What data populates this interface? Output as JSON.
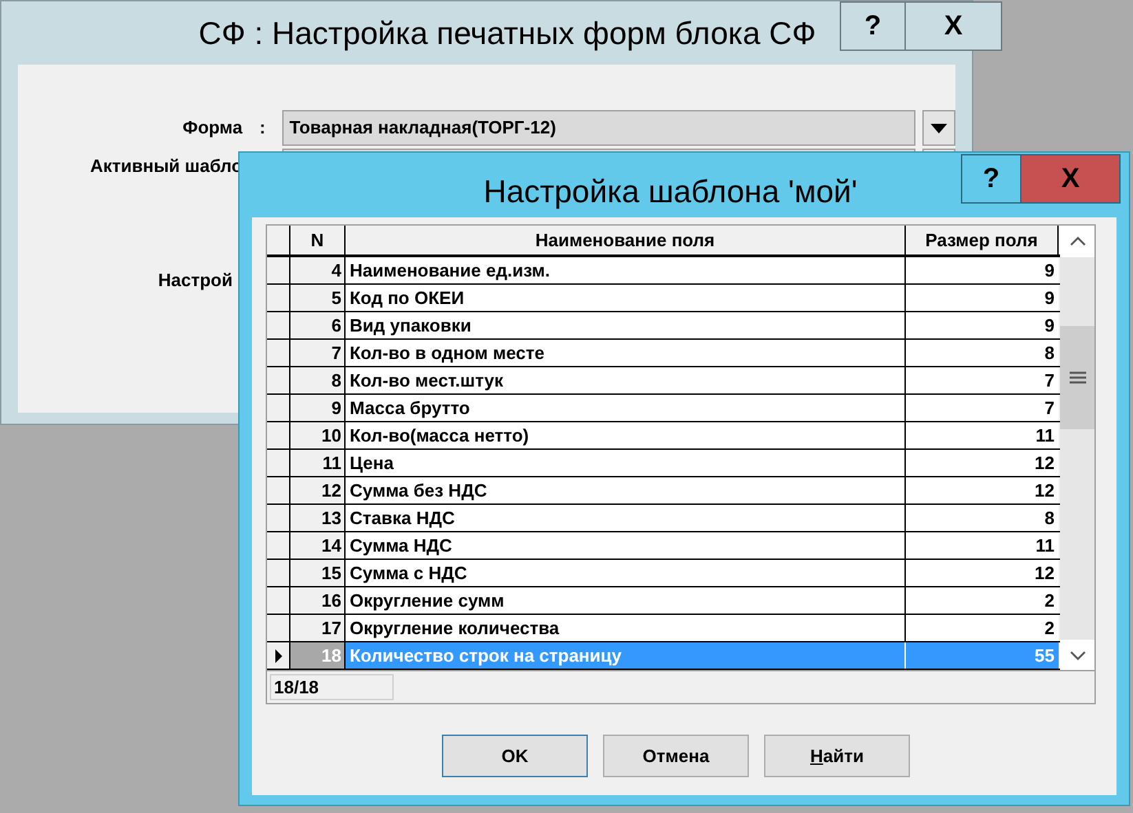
{
  "main_window": {
    "title": "СФ : Настройка печатных форм блока СФ",
    "help_button": "?",
    "close_button": "X",
    "fields": [
      {
        "label": "Форма",
        "separator": ":",
        "value": "Товарная накладная(ТОРГ-12)"
      },
      {
        "label": "Активный шабло"
      }
    ],
    "labels": [
      "Настрой"
    ]
  },
  "dialog": {
    "title": "Настройка шаблона 'мой'",
    "help_button": "?",
    "close_button": "X",
    "table": {
      "columns": [
        "N",
        "Наименование поля",
        "Размер поля"
      ],
      "rows": [
        {
          "n": "4",
          "name": "Наименование ед.изм.",
          "size": "9",
          "selected": false
        },
        {
          "n": "5",
          "name": "Код по ОКЕИ",
          "size": "9",
          "selected": false
        },
        {
          "n": "6",
          "name": "Вид упаковки",
          "size": "9",
          "selected": false
        },
        {
          "n": "7",
          "name": "Кол-во в одном месте",
          "size": "8",
          "selected": false
        },
        {
          "n": "8",
          "name": "Кол-во мест.штук",
          "size": "7",
          "selected": false
        },
        {
          "n": "9",
          "name": "Масса брутто",
          "size": "7",
          "selected": false
        },
        {
          "n": "10",
          "name": "Кол-во(масса нетто)",
          "size": "11",
          "selected": false
        },
        {
          "n": "11",
          "name": "Цена",
          "size": "12",
          "selected": false
        },
        {
          "n": "12",
          "name": "Сумма без НДС",
          "size": "12",
          "selected": false
        },
        {
          "n": "13",
          "name": "Ставка НДС",
          "size": "8",
          "selected": false
        },
        {
          "n": "14",
          "name": "Сумма НДС",
          "size": "11",
          "selected": false
        },
        {
          "n": "15",
          "name": "Сумма с НДС",
          "size": "12",
          "selected": false
        },
        {
          "n": "16",
          "name": "Округление сумм",
          "size": "2",
          "selected": false
        },
        {
          "n": "17",
          "name": "Округление количества",
          "size": "2",
          "selected": false
        },
        {
          "n": "18",
          "name": "Количество строк на страницу",
          "size": "55",
          "selected": true
        }
      ],
      "record_counter": "18/18"
    },
    "buttons": [
      {
        "label": "OK",
        "default": true,
        "mnemonic": false
      },
      {
        "label": "Отмена",
        "default": false,
        "mnemonic": false
      },
      {
        "label": "Найти",
        "default": false,
        "mnemonic": true
      }
    ]
  }
}
